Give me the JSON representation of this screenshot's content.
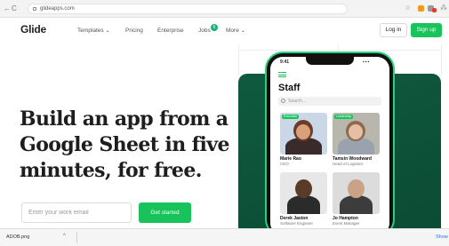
{
  "browser": {
    "url": "glideapps.com",
    "nav": {
      "back": "←",
      "forward": "→",
      "reload": "C"
    },
    "star": "☆",
    "puzzle": "⁂",
    "extension_colors": [
      "#f29b1b",
      "#9a9a9a",
      "#e33b2e"
    ]
  },
  "site": {
    "logo": "Glide",
    "menu": [
      {
        "label": "Templates ⌄"
      },
      {
        "label": "Pricing"
      },
      {
        "label": "Enterprise"
      },
      {
        "label": "Jobs"
      },
      {
        "label": "More ⌄"
      }
    ],
    "jobs_badge": "6",
    "login_label": "Log in",
    "signup_label": "Sign up"
  },
  "hero": {
    "line1": "Build an app from a",
    "line2": "Google Sheet in five",
    "line3": "minutes, for free.",
    "email_placeholder": "Enter your work email",
    "cta_label": "Get started"
  },
  "phone": {
    "time": "9:41",
    "signal": "▪▪▪",
    "title": "Staff",
    "search_placeholder": "Search...",
    "cards": [
      {
        "name": "Marie Rao",
        "role": "CEO",
        "tag": "Executive"
      },
      {
        "name": "Tamsin Woodward",
        "role": "Head of Logistics",
        "tag": "Leadership"
      },
      {
        "name": "Derek Jaston",
        "role": "Software Engineer",
        "tag": ""
      },
      {
        "name": "Jo Hampton",
        "role": "Event Manager",
        "tag": ""
      }
    ]
  },
  "downloads": {
    "file": "ADOB.png",
    "caret": "^",
    "show_all": "Show"
  },
  "colors": {
    "brand_green": "#17c35a",
    "panel_green": "#0f5a3f"
  }
}
